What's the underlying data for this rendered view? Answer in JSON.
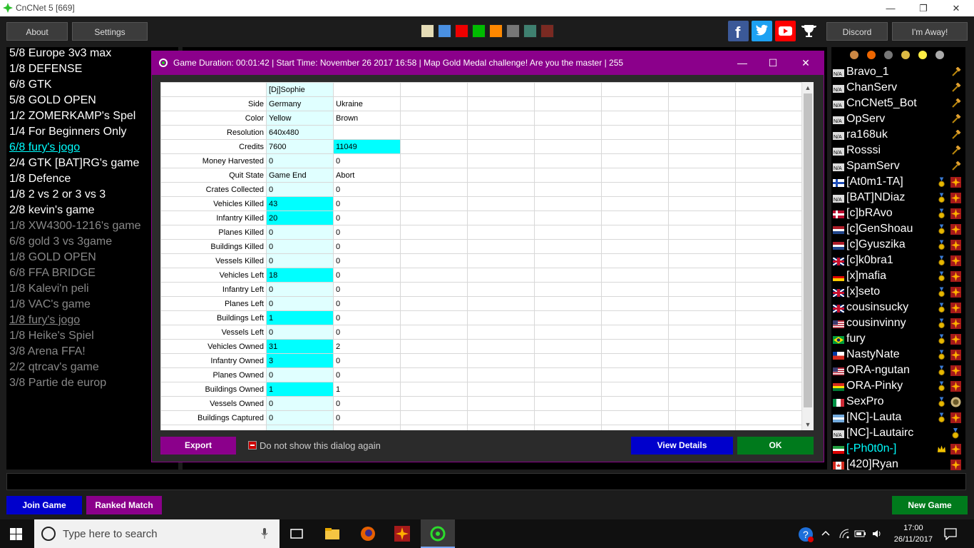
{
  "window": {
    "title": "CnCNet 5 [669]",
    "minimize": "—",
    "restore": "❐",
    "close": "✕"
  },
  "top": {
    "about": "About",
    "settings": "Settings",
    "discord": "Discord",
    "away": "I'm Away!",
    "swatches": [
      "#e5dcb6",
      "#4a90e2",
      "#ee0000",
      "#00bb00",
      "#ff8800",
      "#777777",
      "#3f8070",
      "#7a2a22"
    ]
  },
  "games": [
    {
      "text": "5/8 Europe 3v3 max",
      "color": "#ffffff"
    },
    {
      "text": "1/8 DEFENSE",
      "color": "#ffffff"
    },
    {
      "text": "6/8 GTK",
      "color": "#ffffff"
    },
    {
      "text": "5/8 GOLD OPEN",
      "color": "#ffffff"
    },
    {
      "text": "1/2 ZOMERKAMP's Spel",
      "color": "#ffffff"
    },
    {
      "text": "1/4 For Beginners Only",
      "color": "#ffffff"
    },
    {
      "text": "6/8 fury's jogo",
      "color": "#00ffff"
    },
    {
      "text": "2/4 GTK [BAT]RG's game",
      "color": "#ffffff"
    },
    {
      "text": "1/8 Defence",
      "color": "#ffffff"
    },
    {
      "text": "1/8 2 vs 2 or 3 vs 3",
      "color": "#ffffff"
    },
    {
      "text": "2/8 kevin's game",
      "color": "#ffffff"
    },
    {
      "text": "1/8 XW4300-1216's game",
      "color": "#888888"
    },
    {
      "text": "6/8 gold 3 vs 3game",
      "color": "#888888"
    },
    {
      "text": "1/8 GOLD OPEN",
      "color": "#888888"
    },
    {
      "text": "6/8 FFA  BRIDGE",
      "color": "#888888"
    },
    {
      "text": "1/8 Kalevi'n peli",
      "color": "#888888"
    },
    {
      "text": "1/8 VAC's game",
      "color": "#888888"
    },
    {
      "text": "1/8 fury's jogo",
      "color": "#888888"
    },
    {
      "text": "1/8 Heike's Spiel",
      "color": "#888888"
    },
    {
      "text": "3/8 Arena FFA!",
      "color": "#888888"
    },
    {
      "text": "2/2 qtrcav's game",
      "color": "#888888"
    },
    {
      "text": "3/8 Partie de europ",
      "color": "#888888"
    }
  ],
  "players": [
    {
      "name": "Bravo_1",
      "flag": "na",
      "r1": "",
      "r2": "hammer",
      "color": "#ffffff"
    },
    {
      "name": "ChanServ",
      "flag": "na",
      "r1": "",
      "r2": "hammer",
      "color": "#ffffff"
    },
    {
      "name": "CnCNet5_Bot",
      "flag": "na",
      "r1": "",
      "r2": "hammer",
      "color": "#ffffff"
    },
    {
      "name": "OpServ",
      "flag": "na",
      "r1": "",
      "r2": "hammer",
      "color": "#ffffff"
    },
    {
      "name": "ra168uk",
      "flag": "na",
      "r1": "",
      "r2": "hammer",
      "color": "#ffffff"
    },
    {
      "name": "Rosssi",
      "flag": "na",
      "r1": "",
      "r2": "hammer",
      "color": "#ffffff"
    },
    {
      "name": "SpamServ",
      "flag": "na",
      "r1": "",
      "r2": "hammer",
      "color": "#ffffff"
    },
    {
      "name": "[At0m1-TA]",
      "flag": "fi",
      "r1": "medal",
      "r2": "ra",
      "color": "#ffffff"
    },
    {
      "name": "[BAT]NDiaz",
      "flag": "na",
      "r1": "medal",
      "r2": "ra",
      "color": "#ffffff"
    },
    {
      "name": "[c]bRAvo",
      "flag": "no",
      "r1": "medal",
      "r2": "ra",
      "color": "#ffffff"
    },
    {
      "name": "[c]GenShoau",
      "flag": "nl",
      "r1": "medal",
      "r2": "ra",
      "color": "#ffffff"
    },
    {
      "name": "[c]Gyuszika",
      "flag": "nl",
      "r1": "medal",
      "r2": "ra",
      "color": "#ffffff"
    },
    {
      "name": "[c]k0bra1",
      "flag": "uk",
      "r1": "medal",
      "r2": "ra",
      "color": "#ffffff"
    },
    {
      "name": "[x]mafia",
      "flag": "de",
      "r1": "medal",
      "r2": "ra",
      "color": "#ffffff"
    },
    {
      "name": "[x]seto",
      "flag": "uk",
      "r1": "medal",
      "r2": "ra",
      "color": "#ffffff"
    },
    {
      "name": "cousinsucky",
      "flag": "uk",
      "r1": "medal",
      "r2": "ra",
      "color": "#ffffff"
    },
    {
      "name": "cousinvinny",
      "flag": "us",
      "r1": "medal",
      "r2": "ra",
      "color": "#ffffff"
    },
    {
      "name": "fury",
      "flag": "br",
      "r1": "medal",
      "r2": "ra",
      "color": "#ffffff"
    },
    {
      "name": "NastyNate",
      "flag": "cl",
      "r1": "medal",
      "r2": "ra",
      "color": "#ffffff"
    },
    {
      "name": "ORA-ngutan",
      "flag": "us",
      "r1": "medal",
      "r2": "ra",
      "color": "#ffffff"
    },
    {
      "name": "ORA-Pinky",
      "flag": "bo",
      "r1": "medal",
      "r2": "ra",
      "color": "#ffffff"
    },
    {
      "name": "SexPro",
      "flag": "it",
      "r1": "medal",
      "r2": "ts",
      "color": "#ffffff"
    },
    {
      "name": "[NC]-Lauta",
      "flag": "ar",
      "r1": "medal",
      "r2": "ra",
      "color": "#ffffff"
    },
    {
      "name": "[NC]-Lautairc",
      "flag": "na",
      "r1": "",
      "r2": "medal",
      "color": "#ffffff"
    },
    {
      "name": "[-Ph0t0n-]",
      "flag": "ir",
      "r1": "crown",
      "r2": "ra",
      "color": "#00ffff"
    },
    {
      "name": "[420]Ryan",
      "flag": "ca",
      "r1": "",
      "r2": "ra",
      "color": "#ffffff"
    }
  ],
  "bottom": {
    "join": "Join Game",
    "ranked": "Ranked Match",
    "newgame": "New Game"
  },
  "dialog": {
    "title": "Game Duration: 00:01:42 | Start Time: November 26 2017 16:58 | Map Gold Medal challenge! Are you the master | 255",
    "player1": "[Dj]Sophie",
    "rows": [
      {
        "label": "Side",
        "a": "Germany",
        "b": "Ukraine",
        "ah": false,
        "bh": false
      },
      {
        "label": "Color",
        "a": "Yellow",
        "b": "Brown",
        "ah": false,
        "bh": false
      },
      {
        "label": "Resolution",
        "a": "640x480",
        "b": "",
        "ah": false,
        "bh": false
      },
      {
        "label": "Credits",
        "a": "7600",
        "b": "11049",
        "ah": false,
        "bh": true
      },
      {
        "label": "Money Harvested",
        "a": "0",
        "b": "0",
        "ah": false,
        "bh": false
      },
      {
        "label": "Quit State",
        "a": "Game End",
        "b": "Abort",
        "ah": false,
        "bh": false
      },
      {
        "label": "Crates Collected",
        "a": "0",
        "b": "0",
        "ah": false,
        "bh": false
      },
      {
        "label": "Vehicles Killed",
        "a": "43",
        "b": "0",
        "ah": true,
        "bh": false
      },
      {
        "label": "Infantry Killed",
        "a": "20",
        "b": "0",
        "ah": true,
        "bh": false
      },
      {
        "label": "Planes Killed",
        "a": "0",
        "b": "0",
        "ah": false,
        "bh": false
      },
      {
        "label": "Buildings Killed",
        "a": "0",
        "b": "0",
        "ah": false,
        "bh": false
      },
      {
        "label": "Vessels Killed",
        "a": "0",
        "b": "0",
        "ah": false,
        "bh": false
      },
      {
        "label": "Vehicles Left",
        "a": "18",
        "b": "0",
        "ah": true,
        "bh": false
      },
      {
        "label": "Infantry Left",
        "a": "0",
        "b": "0",
        "ah": false,
        "bh": false
      },
      {
        "label": "Planes Left",
        "a": "0",
        "b": "0",
        "ah": false,
        "bh": false
      },
      {
        "label": "Buildings Left",
        "a": "1",
        "b": "0",
        "ah": true,
        "bh": false
      },
      {
        "label": "Vessels Left",
        "a": "0",
        "b": "0",
        "ah": false,
        "bh": false
      },
      {
        "label": "Vehicles Owned",
        "a": "31",
        "b": "2",
        "ah": true,
        "bh": false
      },
      {
        "label": "Infantry Owned",
        "a": "3",
        "b": "0",
        "ah": true,
        "bh": false
      },
      {
        "label": "Planes Owned",
        "a": "0",
        "b": "0",
        "ah": false,
        "bh": false
      },
      {
        "label": "Buildings Owned",
        "a": "1",
        "b": "1",
        "ah": true,
        "bh": false
      },
      {
        "label": "Vessels Owned",
        "a": "0",
        "b": "0",
        "ah": false,
        "bh": false
      },
      {
        "label": "Buildings Captured",
        "a": "0",
        "b": "0",
        "ah": false,
        "bh": false
      }
    ],
    "export": "Export",
    "dont_show": "Do not show this dialog again",
    "view_details": "View Details",
    "ok": "OK"
  },
  "taskbar": {
    "search_placeholder": "Type here to search",
    "time": "17:00",
    "date": "26/11/2017"
  }
}
